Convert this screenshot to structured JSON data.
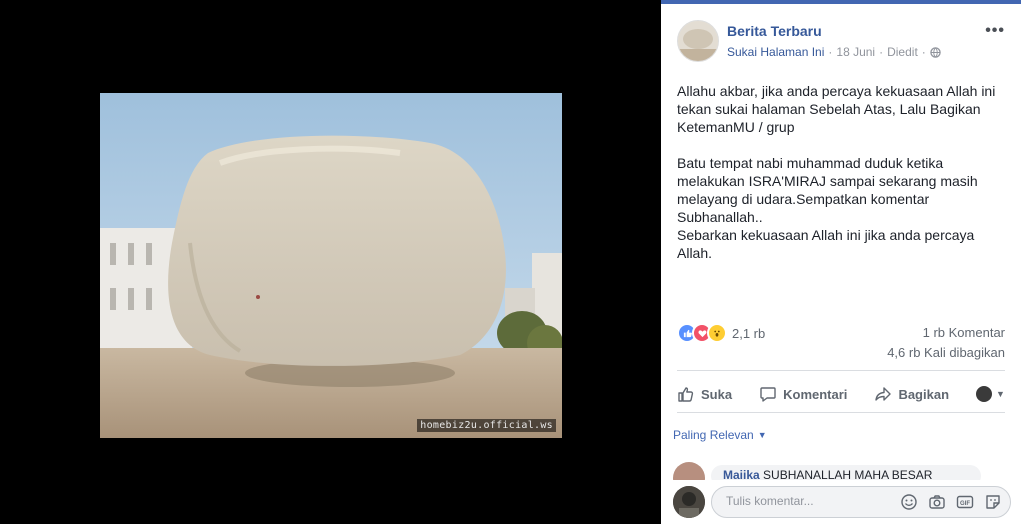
{
  "photo": {
    "watermark": "homebiz2u.official.ws"
  },
  "post": {
    "page_name": "Berita Terbaru",
    "follow_link": "Sukai Halaman Ini",
    "date": "18 Juni",
    "edited": "Diedit",
    "text": "Allahu akbar, jika anda percaya kekuasaan Allah ini tekan sukai halaman Sebelah Atas, Lalu Bagikan KetemanMU / grup\n\nBatu tempat nabi muhammad duduk ketika melakukan ISRA'MIRAJ sampai sekarang masih melayang di udara.Sempatkan komentar Subhanallah..\nSebarkan kekuasaan Allah ini jika anda percaya Allah.",
    "more_label": "•••"
  },
  "stats": {
    "reactions": "2,1 rb",
    "comments": "1 rb Komentar",
    "shares": "4,6 rb Kali dibagikan"
  },
  "actions": {
    "like": "Suka",
    "comment": "Komentari",
    "share": "Bagikan"
  },
  "comments": {
    "sort_label": "Paling Relevan",
    "preview_author": "Maiika",
    "preview_text": "SUBHANALLAH MAHA BESAR",
    "input_placeholder": "Tulis komentar..."
  },
  "colors": {
    "accent": "#4267b2",
    "link": "#365899"
  }
}
